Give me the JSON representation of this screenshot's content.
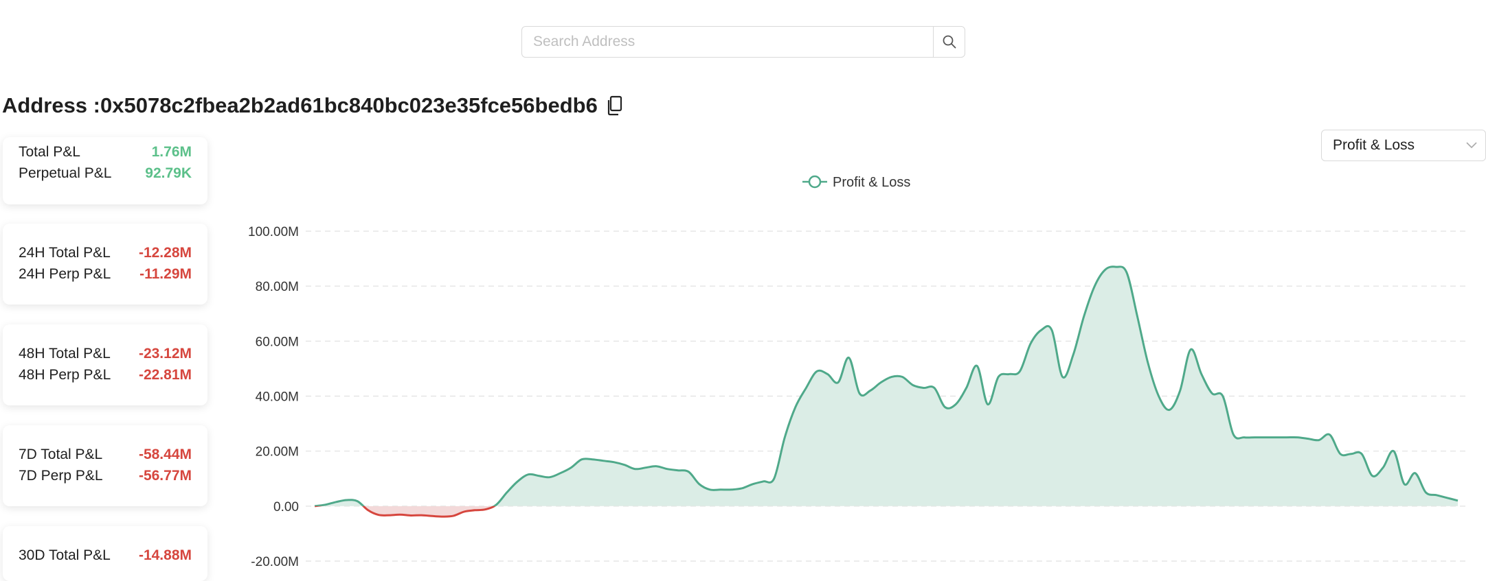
{
  "search": {
    "placeholder": "Search Address"
  },
  "address": {
    "label": "Address :",
    "value": "0x5078c2fbea2b2ad61bc840bc023e35fce56bedb6"
  },
  "cards": [
    {
      "rows": [
        {
          "label": "Total P&L",
          "value": "1.76M",
          "sign": "pos"
        },
        {
          "label": "Perpetual P&L",
          "value": "92.79K",
          "sign": "pos"
        }
      ]
    },
    {
      "rows": [
        {
          "label": "24H Total P&L",
          "value": "-12.28M",
          "sign": "neg"
        },
        {
          "label": "24H Perp P&L",
          "value": "-11.29M",
          "sign": "neg"
        }
      ]
    },
    {
      "rows": [
        {
          "label": "48H Total P&L",
          "value": "-23.12M",
          "sign": "neg"
        },
        {
          "label": "48H Perp P&L",
          "value": "-22.81M",
          "sign": "neg"
        }
      ]
    },
    {
      "rows": [
        {
          "label": "7D Total P&L",
          "value": "-58.44M",
          "sign": "neg"
        },
        {
          "label": "7D Perp P&L",
          "value": "-56.77M",
          "sign": "neg"
        }
      ]
    },
    {
      "rows": [
        {
          "label": "30D Total P&L",
          "value": "-14.88M",
          "sign": "neg"
        }
      ]
    }
  ],
  "metric_select": {
    "value": "Profit & Loss"
  },
  "icons": {
    "search": "search-icon",
    "copy": "copy-icon",
    "dropdown": "chevron-down-icon"
  },
  "colors": {
    "positive": "#5cc08a",
    "negative": "#d6463e",
    "line": "#4fa98a",
    "area": "#dbede6",
    "negative_area": "#f3d9d9"
  },
  "chart_data": {
    "type": "area",
    "title": "",
    "legend": [
      "Profit & Loss"
    ],
    "legend_position": "top-center",
    "grid": true,
    "ylim": [
      -20,
      100
    ],
    "yticks": [
      "100.00M",
      "80.00M",
      "60.00M",
      "40.00M",
      "20.00M",
      "0.00",
      "-20.00M"
    ],
    "ytick_values": [
      100,
      80,
      60,
      40,
      20,
      0,
      -20
    ],
    "y_unit": "M",
    "series": [
      {
        "name": "Profit & Loss",
        "values": [
          0,
          0.5,
          1.5,
          2.2,
          1.8,
          -1.5,
          -3.2,
          -3.3,
          -3.1,
          -3.4,
          -3.3,
          -3.6,
          -3.8,
          -3.5,
          -2,
          -1.5,
          -1.2,
          0.5,
          5,
          9,
          11.5,
          11,
          10.5,
          12,
          14,
          17,
          17,
          16.5,
          16,
          15,
          13.5,
          14,
          14.5,
          13.5,
          13,
          12.5,
          8,
          6,
          6,
          6,
          6.5,
          8,
          9,
          10,
          25,
          36,
          43,
          49,
          48,
          45,
          54,
          41,
          42,
          45,
          47,
          47,
          44,
          43,
          43,
          36,
          37,
          43,
          51,
          37,
          47,
          48,
          49,
          59,
          64,
          64,
          47,
          55,
          69,
          80,
          86,
          87,
          85,
          69,
          52,
          40,
          35,
          42,
          57,
          48,
          41,
          40,
          26,
          25,
          25,
          25,
          25,
          25,
          25,
          24.5,
          24,
          26,
          19,
          19,
          19,
          11,
          14,
          20,
          8,
          12,
          5,
          4,
          3,
          2
        ]
      }
    ]
  }
}
